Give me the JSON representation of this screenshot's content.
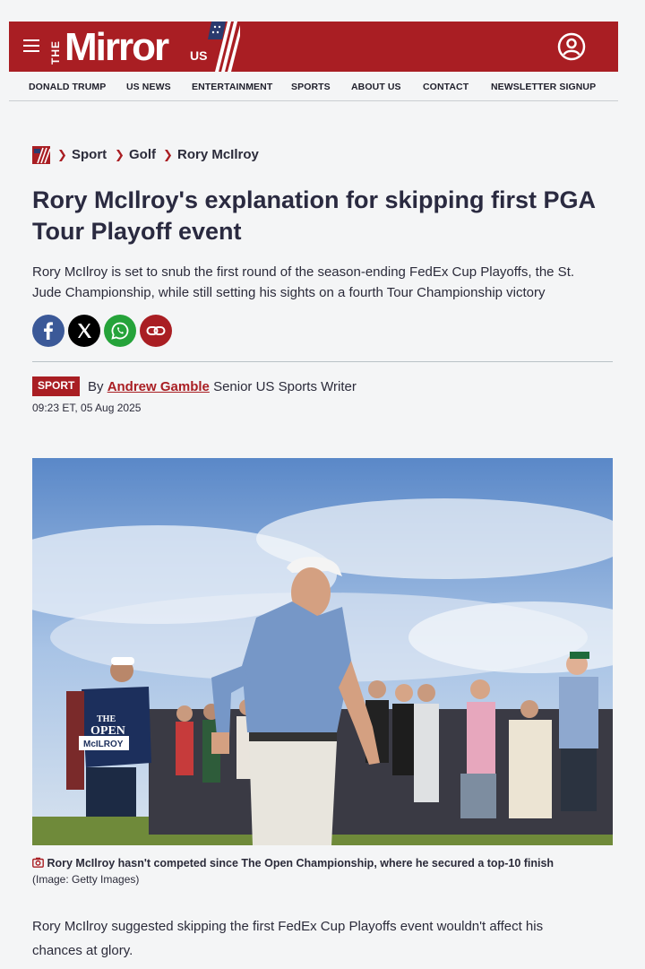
{
  "header": {
    "logo_the": "THE",
    "logo_name": "Mirror",
    "logo_us": "US"
  },
  "nav": {
    "items": [
      {
        "label": "DONALD TRUMP"
      },
      {
        "label": "US NEWS"
      },
      {
        "label": "ENTERTAINMENT"
      },
      {
        "label": "SPORTS"
      },
      {
        "label": "ABOUT US"
      },
      {
        "label": "CONTACT"
      },
      {
        "label": "NEWSLETTER SIGNUP"
      }
    ]
  },
  "breadcrumb": {
    "items": [
      {
        "label": "Sport"
      },
      {
        "label": "Golf"
      },
      {
        "label": "Rory McIlroy"
      }
    ]
  },
  "article": {
    "title": "Rory McIlroy's explanation for skipping first PGA Tour Playoff event",
    "standfirst": "Rory McIlroy is set to snub the first round of the season-ending FedEx Cup Playoffs, the St. Jude Championship, while still setting his sights on a fourth Tour Championship victory",
    "tag": "SPORT",
    "by": "By",
    "author": "Andrew Gamble",
    "author_role": "Senior US Sports Writer",
    "timestamp": "09:23 ET, 05 Aug 2025",
    "caption_text": "Rory McIlroy hasn't competed since The Open Championship, where he secured a top-10 finish",
    "caption_credit": "(Image: Getty Images)",
    "body_first": "Rory McIlroy suggested skipping the first FedEx Cup Playoffs event wouldn't affect his chances at glory."
  },
  "image_labels": {
    "bib_the": "THE",
    "bib_open": "OPEN",
    "bib_name": "McILROY"
  },
  "share": [
    {
      "icon": "facebook-icon",
      "color": "#3b5998"
    },
    {
      "icon": "x-icon",
      "color": "#000000"
    },
    {
      "icon": "whatsapp-icon",
      "color": "#25a33a"
    },
    {
      "icon": "link-icon",
      "color": "#a91e23"
    }
  ],
  "colors": {
    "brand": "#a91e23",
    "background": "#f4f5f6",
    "text": "#2b2b3a"
  }
}
